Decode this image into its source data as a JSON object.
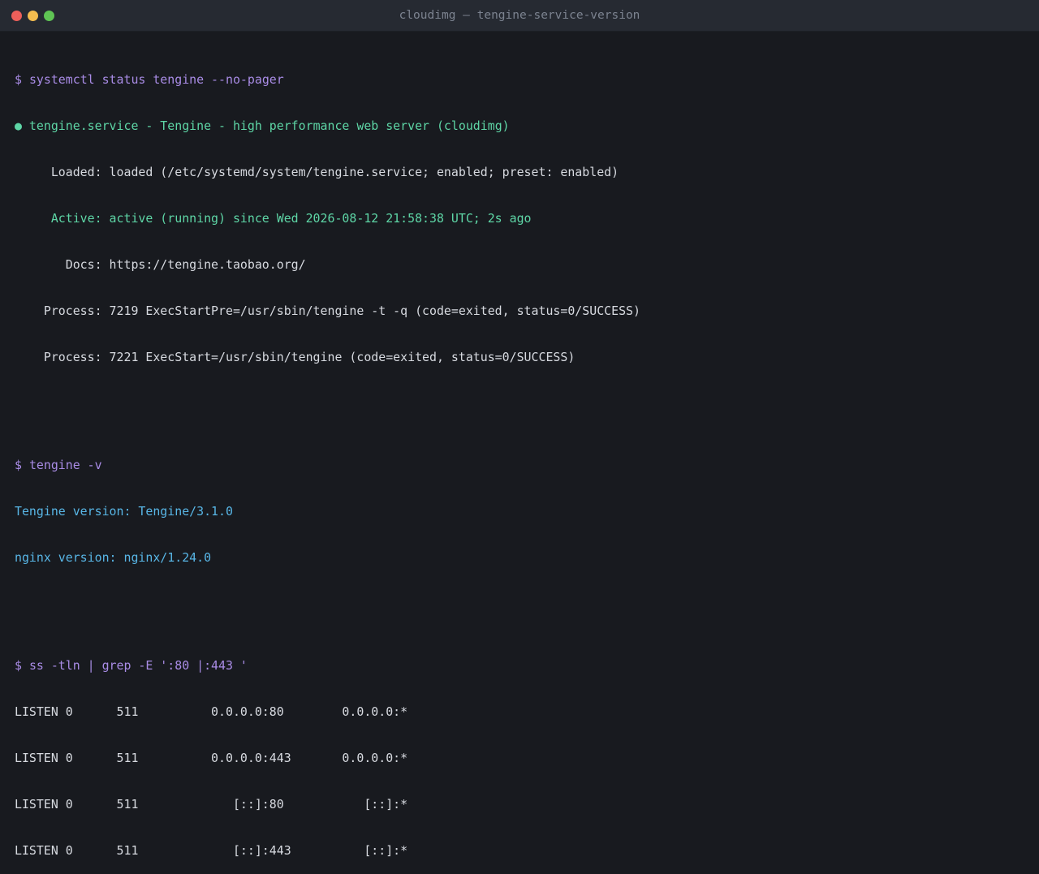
{
  "window": {
    "title": "cloudimg — tengine-service-version"
  },
  "terminal": {
    "block1": {
      "prompt": "$ ",
      "command": "systemctl status tengine --no-pager",
      "status_dot": "●",
      "service_line": " tengine.service - Tengine - high performance web server (cloudimg)",
      "loaded": "     Loaded: loaded (/etc/systemd/system/tengine.service; enabled; preset: enabled)",
      "active": "     Active: active (running) since Wed 2026-08-12 21:58:38 UTC; 2s ago",
      "docs": "       Docs: https://tengine.taobao.org/",
      "process1": "    Process: 7219 ExecStartPre=/usr/sbin/tengine -t -q (code=exited, status=0/SUCCESS)",
      "process2": "    Process: 7221 ExecStart=/usr/sbin/tengine (code=exited, status=0/SUCCESS)"
    },
    "block2": {
      "prompt": "$ ",
      "command": "tengine -v",
      "tengine_version": "Tengine version: Tengine/3.1.0",
      "nginx_version": "nginx version: nginx/1.24.0"
    },
    "block3": {
      "prompt": "$ ",
      "command": "ss -tln | grep -E ':80 |:443 '",
      "rows": [
        "LISTEN 0      511          0.0.0.0:80        0.0.0.0:*",
        "LISTEN 0      511          0.0.0.0:443       0.0.0.0:*",
        "LISTEN 0      511             [::]:80           [::]:*",
        "LISTEN 0      511             [::]:443          [::]:*"
      ]
    }
  },
  "colors": {
    "background": "#181a1f",
    "titlebar": "#262a32",
    "prompt": "#a98ce6",
    "success": "#5ed6a6",
    "info": "#58b6e6",
    "text": "#d7dae0"
  }
}
